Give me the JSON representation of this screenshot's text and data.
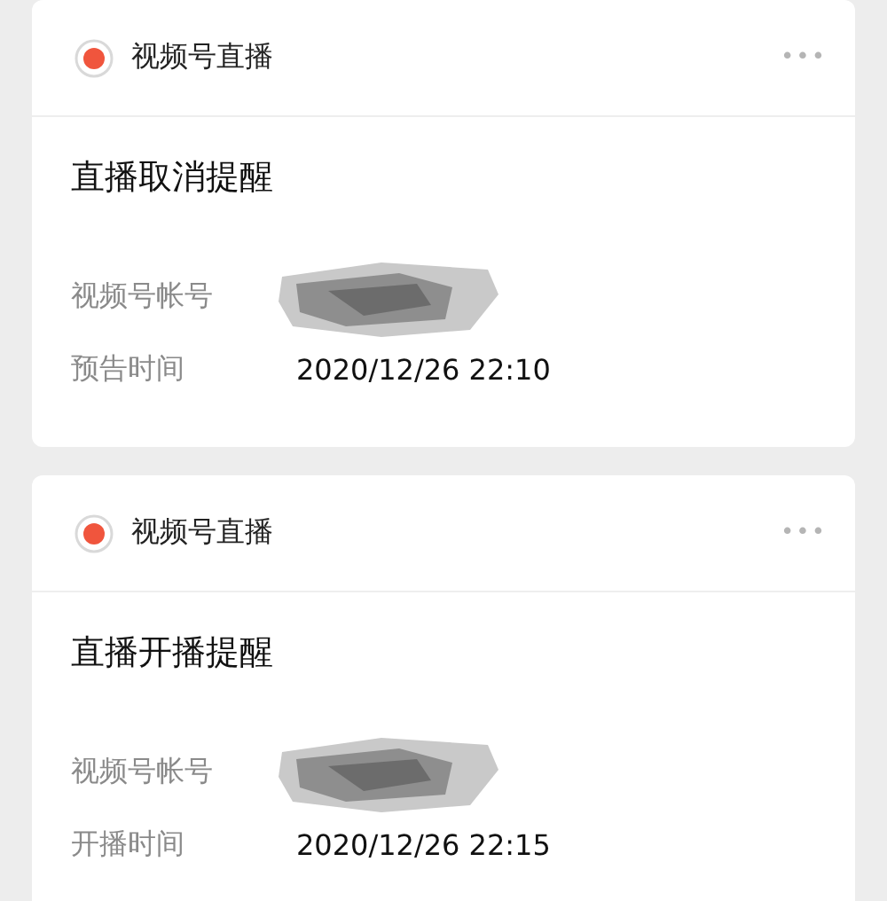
{
  "cards": [
    {
      "source": "视频号直播",
      "more": "•••",
      "title": "直播取消提醒",
      "fields": [
        {
          "label": "视频号帐号",
          "kind": "redacted"
        },
        {
          "label": "预告时间",
          "kind": "text",
          "value": "2020/12/26 22:10"
        }
      ]
    },
    {
      "source": "视频号直播",
      "more": "•••",
      "title": "直播开播提醒",
      "fields": [
        {
          "label": "视频号帐号",
          "kind": "redacted"
        },
        {
          "label": "开播时间",
          "kind": "text",
          "value": "2020/12/26 22:15"
        }
      ]
    }
  ]
}
